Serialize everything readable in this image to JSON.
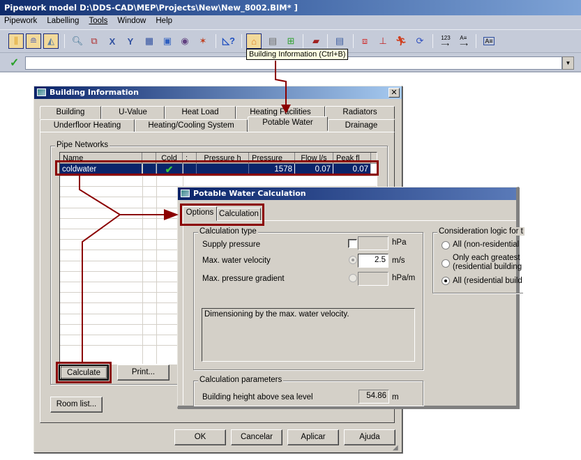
{
  "app": {
    "title": "Pipework model  D:\\DDS-CAD\\MEP\\Projects\\New\\New_8002.BIM* ]",
    "menu": [
      "Pipework",
      "Labelling",
      "Tools",
      "Window",
      "Help"
    ],
    "toolbar_icons": [
      "pipework-icon",
      "layer-icon",
      "landscape-icon",
      "zoom-icon",
      "window-zoom-icon",
      "x-axis-icon",
      "y-axis-icon",
      "table-icon",
      "view-icon",
      "eye-icon",
      "wand-icon",
      "ruler-help-icon",
      "building-information-icon",
      "layers-icon",
      "network-icon",
      "folder-icon",
      "document-icon",
      "export-icon",
      "dimension-icon",
      "runner-icon",
      "update-icon",
      "numbering-icon",
      "text-number-icon",
      "text-icon"
    ],
    "tooltip": "Building Information  (Ctrl+B)",
    "command_input": ""
  },
  "building_info": {
    "title": "Building Information",
    "tabs_row1": [
      "Building",
      "U-Value",
      "Heat Load",
      "Heating Facilities",
      "Radiators"
    ],
    "tabs_row2": [
      "Underfloor Heating",
      "Heating/Cooling System",
      "Potable Water",
      "Drainage"
    ],
    "active_tab": "Potable Water",
    "group_label": "Pipe Networks",
    "table": {
      "columns": [
        "Name",
        "",
        "Cold",
        ":",
        "Pressure h",
        "Pressure",
        "Flow  l/s",
        "Peak fl"
      ],
      "rows": [
        {
          "name": "coldwater",
          "blank": "",
          "cold": "✔",
          "sep": "",
          "pressure_h": "",
          "pressure": "1578",
          "flow": "0.07",
          "peak": "0.07"
        }
      ]
    },
    "calculate_label": "Calculate",
    "print_label": "Print...",
    "room_list_label": "Room list...",
    "ok_label": "OK",
    "cancel_label": "Cancelar",
    "apply_label": "Aplicar",
    "help_label": "Ajuda"
  },
  "potable_water_calc": {
    "title": "Potable Water Calculation",
    "tabs": [
      "Options",
      "Calculation"
    ],
    "active_tab": "Options",
    "calc_type": {
      "label": "Calculation type",
      "supply_pressure": {
        "label": "Supply pressure",
        "value": "",
        "unit": "hPa",
        "checked": false
      },
      "max_velocity": {
        "label": "Max. water velocity",
        "value": "2.5",
        "unit": "m/s",
        "selected": true
      },
      "max_gradient": {
        "label": "Max. pressure gradient",
        "value": "",
        "unit": "hPa/m",
        "selected": false
      },
      "description": "Dimensioning by the max. water velocity."
    },
    "consideration": {
      "label": "Consideration logic for t",
      "options": [
        {
          "label": "All (non-residential",
          "selected": false
        },
        {
          "label": "Only each greatest",
          "label2": "(residential building",
          "selected": false
        },
        {
          "label": "All (residential build",
          "selected": true
        }
      ]
    },
    "calc_params": {
      "label": "Calculation parameters",
      "height_label": "Building height above sea level",
      "height_value": "54.86",
      "height_unit": "m"
    }
  },
  "colors": {
    "annotation": "#8b0000",
    "selection": "#0a246a",
    "dialog_bg": "#d4d0c8"
  }
}
